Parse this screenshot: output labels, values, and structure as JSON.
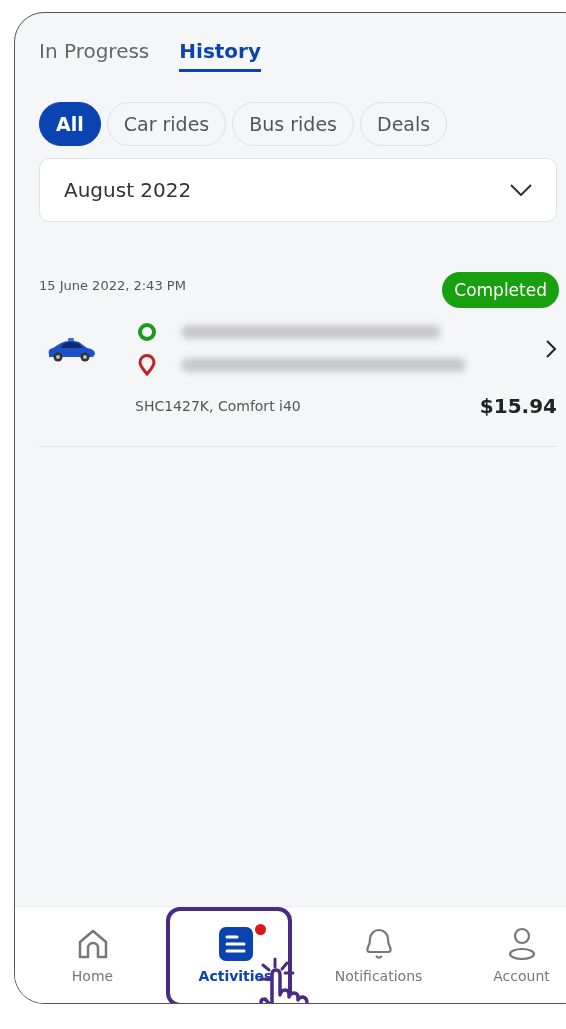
{
  "tabs": [
    {
      "label": "In Progress",
      "selected": false
    },
    {
      "label": "History",
      "selected": true
    }
  ],
  "filters": [
    {
      "label": "All",
      "selected": true
    },
    {
      "label": "Car rides",
      "selected": false
    },
    {
      "label": "Bus rides",
      "selected": false
    },
    {
      "label": "Deals",
      "selected": false
    }
  ],
  "month_select": {
    "value": "August 2022"
  },
  "rides": [
    {
      "datetime": "15 June 2022, 2:43 PM",
      "status": "Completed",
      "vehicle": "SHC1427K, Comfort i40",
      "price": "$15.94"
    }
  ],
  "nav": [
    {
      "label": "Home",
      "kind": "home",
      "selected": false,
      "badge": false
    },
    {
      "label": "Activities",
      "kind": "activities",
      "selected": true,
      "badge": true
    },
    {
      "label": "Notifications",
      "kind": "notifications",
      "selected": false,
      "badge": false
    },
    {
      "label": "Account",
      "kind": "account",
      "selected": false,
      "badge": false
    }
  ]
}
